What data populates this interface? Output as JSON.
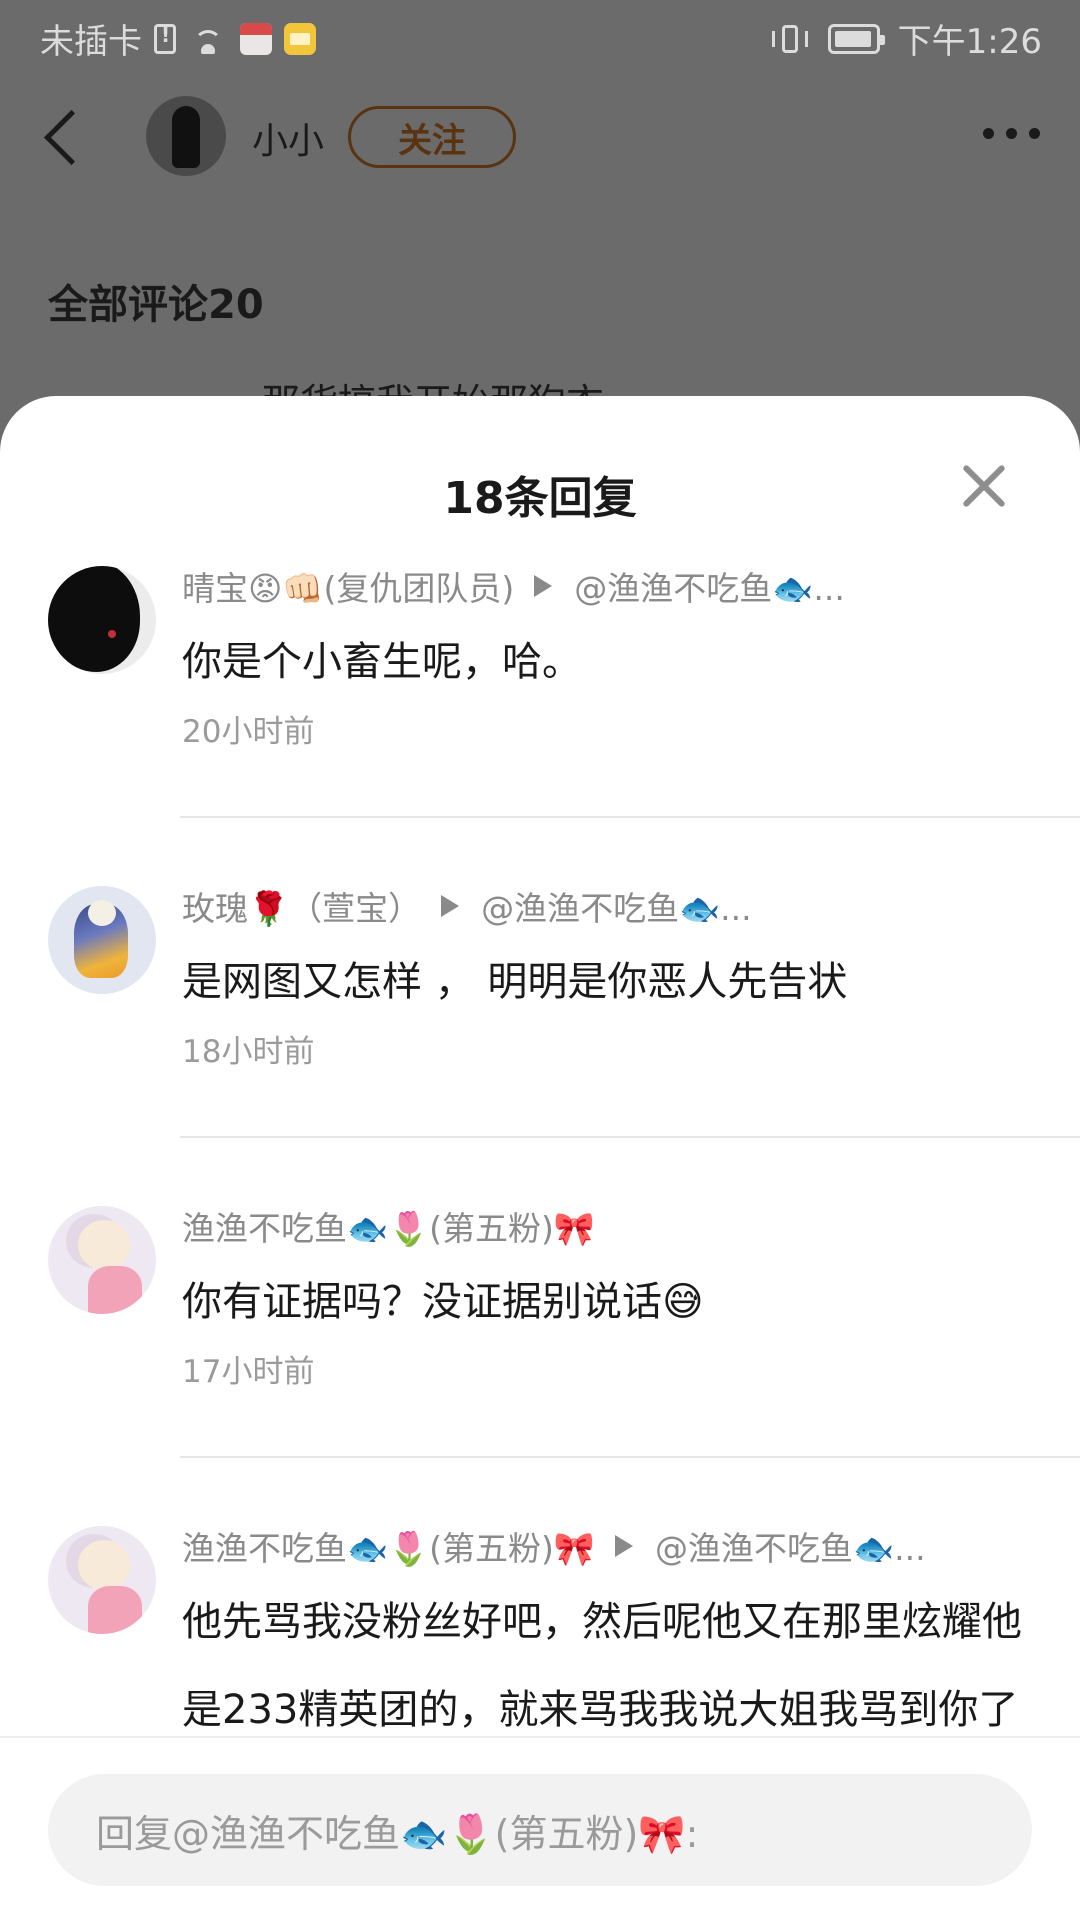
{
  "status_bar": {
    "carrier": "未插卡",
    "time": "下午1:26"
  },
  "header": {
    "author_name": "小小",
    "follow_label": "关注"
  },
  "comments": {
    "count_label": "全部评论20",
    "peek_text": "那货搞我开始那狗衣"
  },
  "sheet": {
    "title": "18条回复",
    "replies": [
      {
        "meta": "晴宝😡👊🏻(复仇团队员)",
        "reply_to": "@渔渔不吃鱼🐟...",
        "text": "你是个小畜生呢，哈。",
        "time": "20小时前"
      },
      {
        "meta": "玫瑰🌹（萱宝）",
        "reply_to": "@渔渔不吃鱼🐟...",
        "text": "是网图又怎样 ，  明明是你恶人先告状",
        "time": "18小时前"
      },
      {
        "meta": "渔渔不吃鱼🐟🌷(第五粉)🎀",
        "reply_to": "",
        "text": "你有证据吗？没证据别说话😅",
        "time": "17小时前"
      },
      {
        "meta": "渔渔不吃鱼🐟🌷(第五粉)🎀",
        "reply_to": "@渔渔不吃鱼🐟...",
        "text": "他先骂我没粉丝好吧，然后呢他又在那里炫耀他是233精英团的，就来骂我我说大姐我骂到你了能明明是先恶人先告状怎么又扯到我身上",
        "time": ""
      }
    ]
  },
  "input": {
    "placeholder": "回复@渔渔不吃鱼🐟🌷(第五粉)🎀:"
  }
}
